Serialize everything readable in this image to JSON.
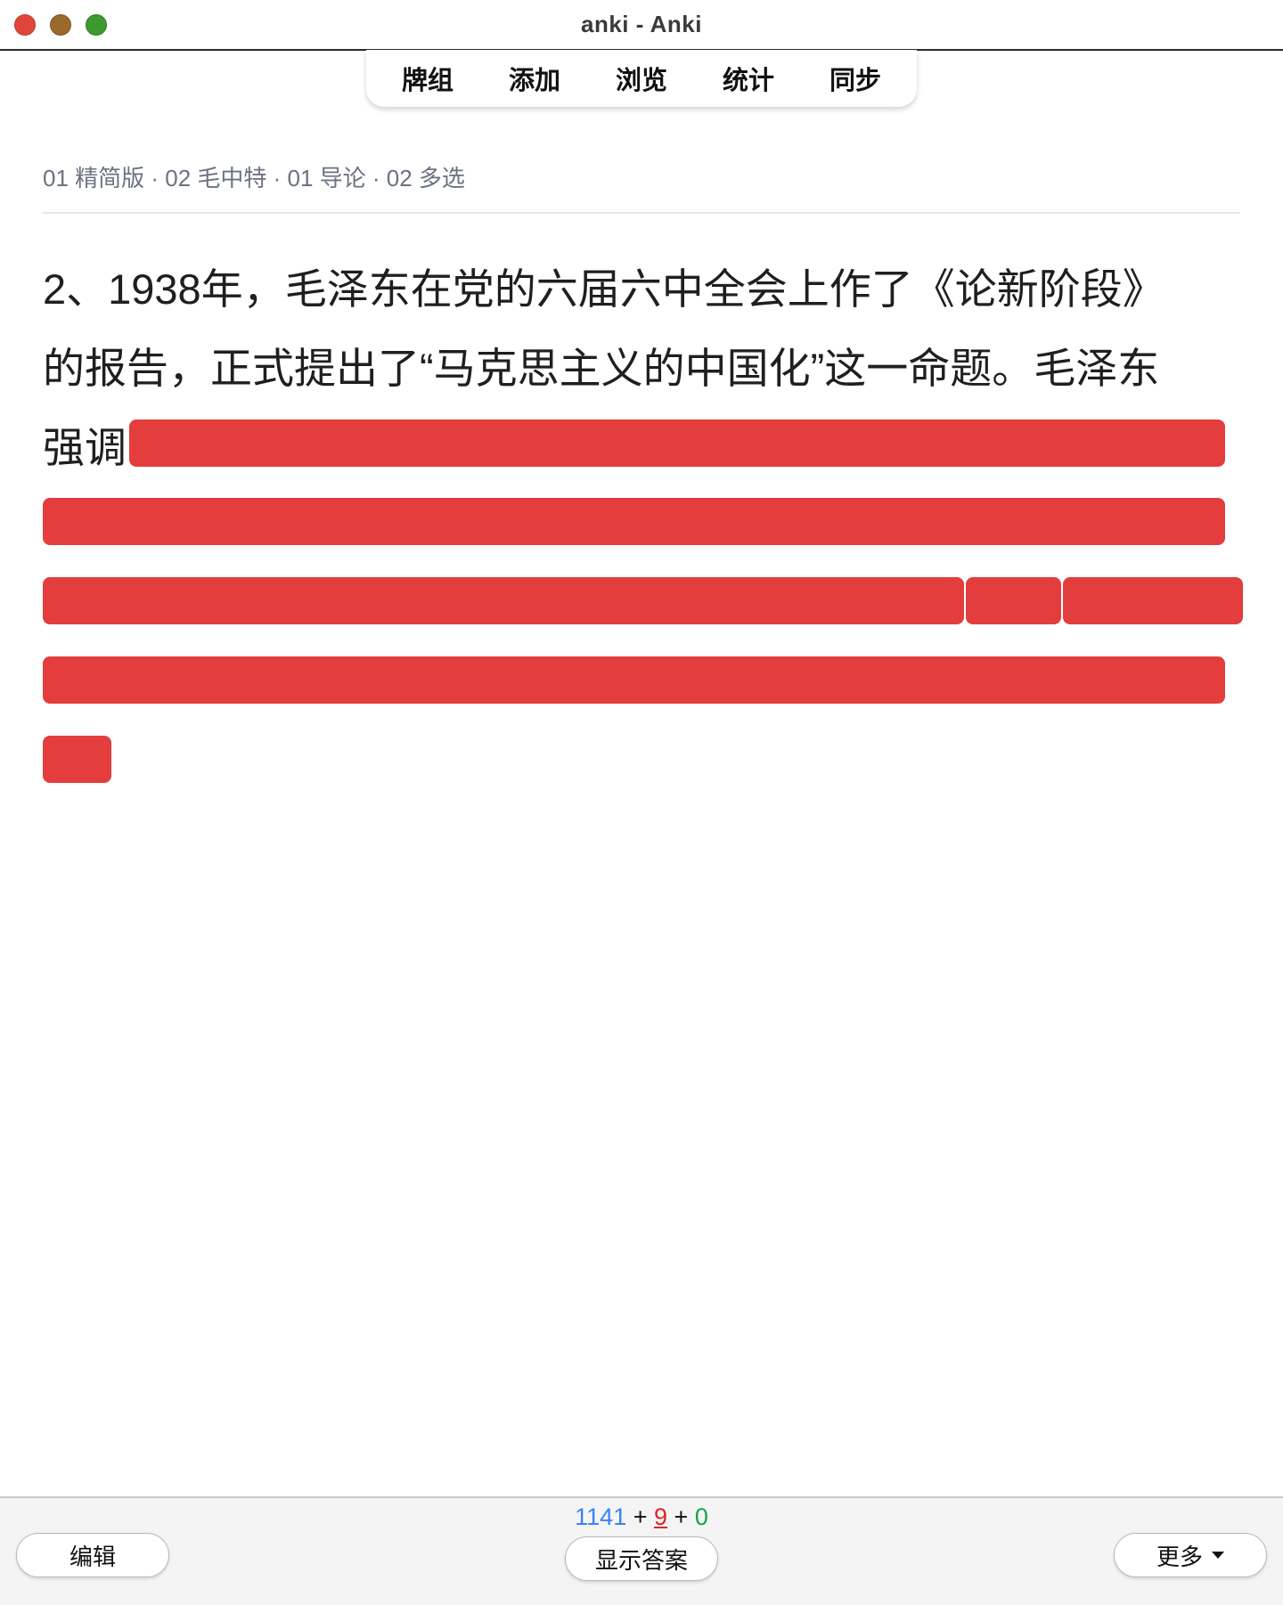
{
  "window": {
    "title": "anki - Anki"
  },
  "nav": {
    "decks": "牌组",
    "add": "添加",
    "browse": "浏览",
    "stats": "统计",
    "sync": "同步"
  },
  "deck_path": "01 精简版 · 02 毛中特 · 01 导论 · 02 多选",
  "question": {
    "line1": "2、1938年，毛泽东在党的六届六中全会上作了《论新阶段》",
    "line2": "的报告，正式提出了“马克思主义的中国化”这一命题。毛泽东",
    "line3": "强调"
  },
  "counts": {
    "new": "1141",
    "learn": "9",
    "review": "0",
    "sep1": " + ",
    "sep2": " + "
  },
  "buttons": {
    "edit": "编辑",
    "show_answer": "显示答案",
    "more": "更多"
  },
  "colors": {
    "cloze": "#e33d3d",
    "new": "#3b82f6",
    "learn": "#dc2626",
    "review": "#16a34a"
  }
}
